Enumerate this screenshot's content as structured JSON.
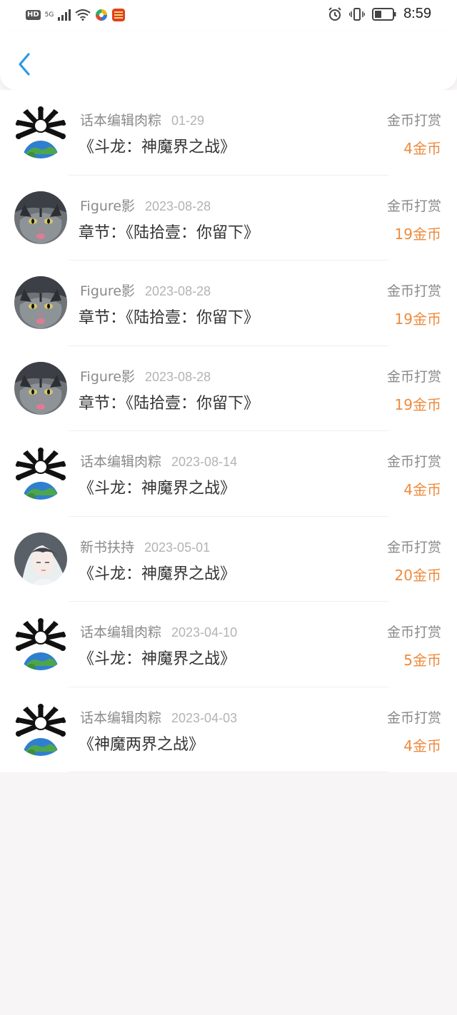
{
  "status_bar": {
    "hd": "HD",
    "network": "5G",
    "time": "8:59",
    "icons": [
      "signal-icon",
      "wifi-icon",
      "app-icon",
      "app-icon",
      "alarm-icon",
      "vibrate-icon",
      "battery-icon"
    ]
  },
  "header": {
    "back_icon": "back-chevron-icon"
  },
  "records": [
    {
      "name": "话本编辑肉粽",
      "date": "01-29",
      "title": "《斗龙：神魔界之战》",
      "type": "金币打赏",
      "amount": "4金币",
      "avatar": "skull-globe"
    },
    {
      "name": "Figure影",
      "date": "2023-08-28",
      "title": "章节：《陆拾壹：你留下》",
      "type": "金币打赏",
      "amount": "19金币",
      "avatar": "cat"
    },
    {
      "name": "Figure影",
      "date": "2023-08-28",
      "title": "章节：《陆拾壹：你留下》",
      "type": "金币打赏",
      "amount": "19金币",
      "avatar": "cat"
    },
    {
      "name": "Figure影",
      "date": "2023-08-28",
      "title": "章节：《陆拾壹：你留下》",
      "type": "金币打赏",
      "amount": "19金币",
      "avatar": "cat"
    },
    {
      "name": "话本编辑肉粽",
      "date": "2023-08-14",
      "title": "《斗龙：神魔界之战》",
      "type": "金币打赏",
      "amount": "4金币",
      "avatar": "skull-globe"
    },
    {
      "name": "新书扶持",
      "date": "2023-05-01",
      "title": "《斗龙：神魔界之战》",
      "type": "金币打赏",
      "amount": "20金币",
      "avatar": "anime"
    },
    {
      "name": "话本编辑肉粽",
      "date": "2023-04-10",
      "title": "《斗龙：神魔界之战》",
      "type": "金币打赏",
      "amount": "5金币",
      "avatar": "skull-globe"
    },
    {
      "name": "话本编辑肉粽",
      "date": "2023-04-03",
      "title": "《神魔两界之战》",
      "type": "金币打赏",
      "amount": "4金币",
      "avatar": "skull-globe"
    }
  ],
  "colors": {
    "accent": "#2a9be8",
    "amount": "#ee8a3c",
    "muted": "#8a8a8a"
  }
}
